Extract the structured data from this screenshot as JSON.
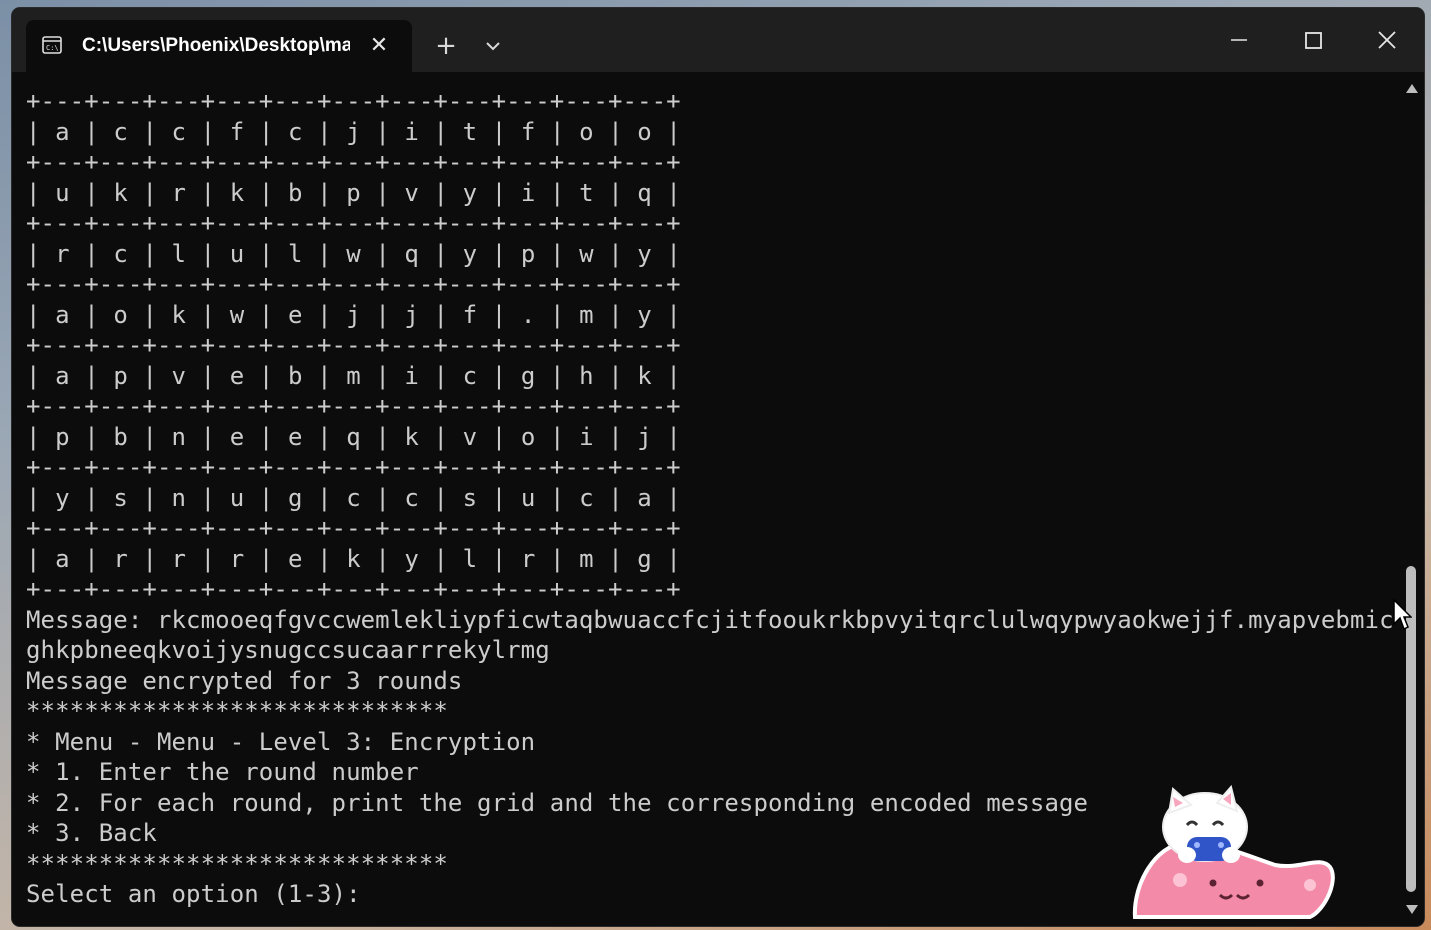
{
  "window": {
    "tab_title": "C:\\Users\\Phoenix\\Desktop\\ma",
    "tab_icon": "terminal-icon",
    "new_tab_icon": "plus-icon",
    "dropdown_icon": "chevron-down-icon",
    "controls": [
      "minimize-icon",
      "maximize-icon",
      "close-icon"
    ]
  },
  "grid": {
    "separator": "+---+---+---+---+---+---+---+---+---+---+---+",
    "rows": [
      [
        "a",
        "c",
        "c",
        "f",
        "c",
        "j",
        "i",
        "t",
        "f",
        "o",
        "o"
      ],
      [
        "u",
        "k",
        "r",
        "k",
        "b",
        "p",
        "v",
        "y",
        "i",
        "t",
        "q"
      ],
      [
        "r",
        "c",
        "l",
        "u",
        "l",
        "w",
        "q",
        "y",
        "p",
        "w",
        "y"
      ],
      [
        "a",
        "o",
        "k",
        "w",
        "e",
        "j",
        "j",
        "f",
        ".",
        "m",
        "y"
      ],
      [
        "a",
        "p",
        "v",
        "e",
        "b",
        "m",
        "i",
        "c",
        "g",
        "h",
        "k"
      ],
      [
        "p",
        "b",
        "n",
        "e",
        "e",
        "q",
        "k",
        "v",
        "o",
        "i",
        "j"
      ],
      [
        "y",
        "s",
        "n",
        "u",
        "g",
        "c",
        "c",
        "s",
        "u",
        "c",
        "a"
      ],
      [
        "a",
        "r",
        "r",
        "r",
        "e",
        "k",
        "y",
        "l",
        "r",
        "m",
        "g"
      ]
    ]
  },
  "output_lines": [
    "Message: rkcmooeqfgvccwemlekliypficwtaqbwuaccfcjitfooukrkbpvyitqrclulwqypwyaokwejjf.myapvebmic",
    "ghkpbneeqkvoijysnugccsucaarrrekylrmg",
    "Message encrypted for 3 rounds",
    "*****************************",
    "* Menu - Menu - Level 3: Encryption",
    "* 1. Enter the round number",
    "* 2. For each round, print the grid and the corresponding encoded message",
    "* 3. Back",
    "*****************************",
    "Select an option (1-3): "
  ],
  "decorations": {
    "mascot": "pink-cat-mascot",
    "cursor": "mouse-pointer-icon"
  }
}
